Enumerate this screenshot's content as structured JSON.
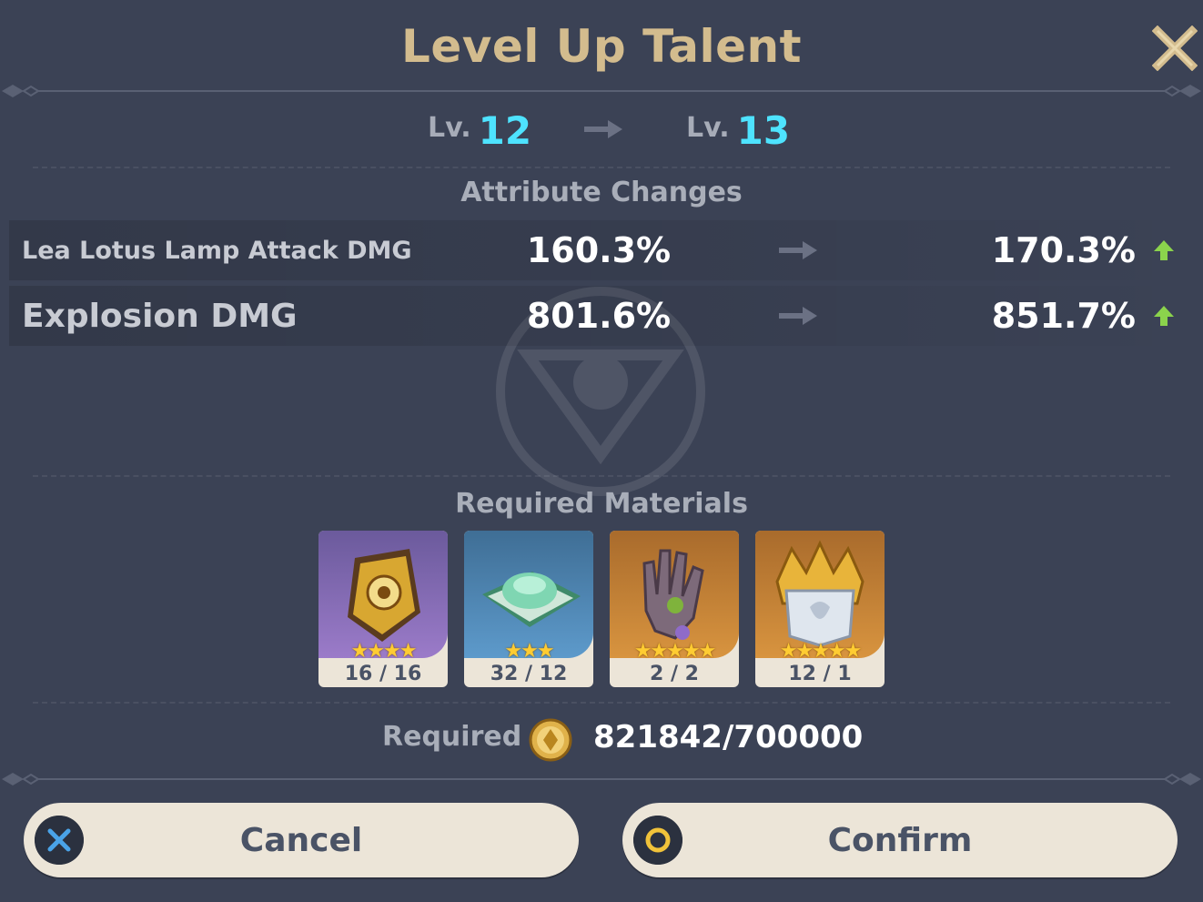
{
  "dialog": {
    "title": "Level Up Talent"
  },
  "level": {
    "label": "Lv.",
    "current": "12",
    "next": "13"
  },
  "attributes": {
    "heading": "Attribute Changes",
    "rows": [
      {
        "name": "Lea Lotus Lamp Attack DMG",
        "old": "160.3%",
        "new": "170.3%"
      },
      {
        "name": "Explosion DMG",
        "old": "801.6%",
        "new": "851.7%"
      }
    ]
  },
  "materials": {
    "heading": "Required Materials",
    "items": [
      {
        "icon": "talent-book-icon",
        "stars": "★★★★",
        "count": "16 / 16",
        "rarity_color": "#8a6fb8"
      },
      {
        "icon": "crystal-tray-icon",
        "stars": "★★★",
        "count": "32 / 12",
        "rarity_color": "#4f86b5"
      },
      {
        "icon": "puppet-hand-icon",
        "stars": "★★★★★",
        "count": "2 / 2",
        "rarity_color": "#c5843a"
      },
      {
        "icon": "crown-icon",
        "stars": "★★★★★",
        "count": "12 / 1",
        "rarity_color": "#c5843a"
      }
    ]
  },
  "mora": {
    "label": "Required",
    "icon": "mora-coin-icon",
    "value": "821842/700000"
  },
  "buttons": {
    "cancel": "Cancel",
    "confirm": "Confirm"
  },
  "colors": {
    "background": "#3b4255",
    "title_gold": "#d3bc8e",
    "level_cyan": "#4ee3ff",
    "increase_green": "#8bd34c",
    "button_cream": "#ece5d8"
  }
}
